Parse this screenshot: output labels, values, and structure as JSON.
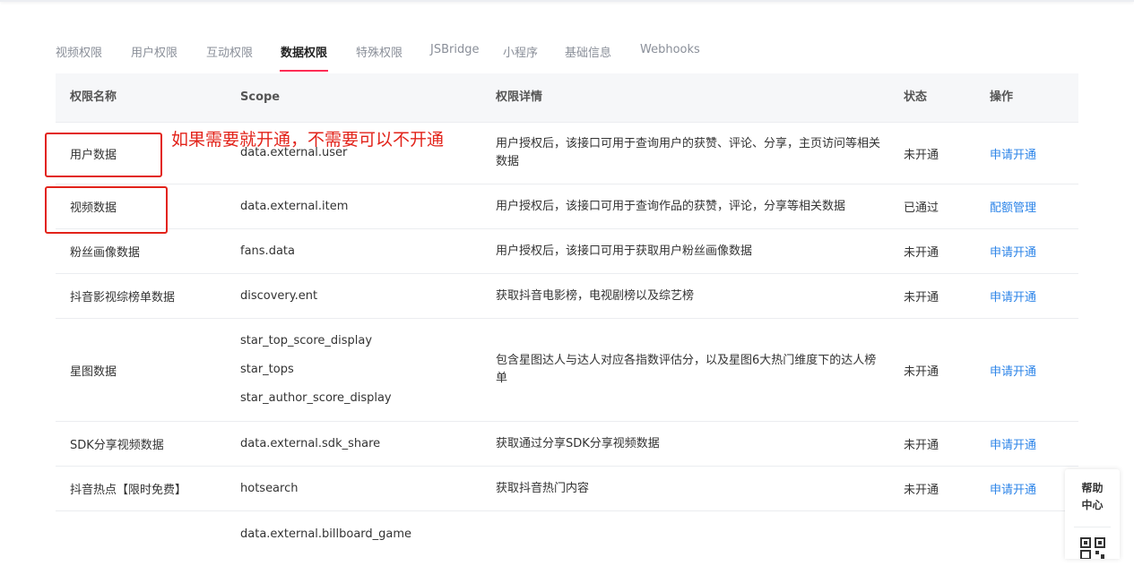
{
  "tabs": [
    {
      "label": "视频权限",
      "active": false
    },
    {
      "label": "用户权限",
      "active": false
    },
    {
      "label": "互动权限",
      "active": false
    },
    {
      "label": "数据权限",
      "active": true
    },
    {
      "label": "特殊权限",
      "active": false
    },
    {
      "label": "JSBridge",
      "active": false
    },
    {
      "label": "小程序",
      "active": false
    },
    {
      "label": "基础信息",
      "active": false
    },
    {
      "label": "Webhooks",
      "active": false
    }
  ],
  "accent_color": "#fe2c55",
  "link_color": "#2c84e8",
  "table": {
    "headers": {
      "name": "权限名称",
      "scope": "Scope",
      "detail": "权限详情",
      "status": "状态",
      "op": "操作"
    },
    "rows": [
      {
        "name": "用户数据",
        "scopes": [
          "data.external.user"
        ],
        "detail": "用户授权后，该接口可用于查询用户的获赞、评论、分享，主页访问等相关数据",
        "status": "未开通",
        "op": "申请开通"
      },
      {
        "name": "视频数据",
        "scopes": [
          "data.external.item"
        ],
        "detail": "用户授权后，该接口可用于查询作品的获赞，评论，分享等相关数据",
        "status": "已通过",
        "op": "配额管理"
      },
      {
        "name": "粉丝画像数据",
        "scopes": [
          "fans.data"
        ],
        "detail": "用户授权后，该接口可用于获取用户粉丝画像数据",
        "status": "未开通",
        "op": "申请开通"
      },
      {
        "name": "抖音影视综榜单数据",
        "scopes": [
          "discovery.ent"
        ],
        "detail": "获取抖音电影榜，电视剧榜以及综艺榜",
        "status": "未开通",
        "op": "申请开通"
      },
      {
        "name": "星图数据",
        "scopes": [
          "star_top_score_display",
          "star_tops",
          "star_author_score_display"
        ],
        "detail": "包含星图达人与达人对应各指数评估分，以及星图6大热门维度下的达人榜单",
        "status": "未开通",
        "op": "申请开通"
      },
      {
        "name": "SDK分享视频数据",
        "scopes": [
          "data.external.sdk_share"
        ],
        "detail": "获取通过分享SDK分享视频数据",
        "status": "未开通",
        "op": "申请开通"
      },
      {
        "name": "抖音热点【限时免费】",
        "scopes": [
          "hotsearch"
        ],
        "detail": "获取抖音热门内容",
        "status": "未开通",
        "op": "申请开通"
      },
      {
        "name": "",
        "scopes": [
          "data.external.billboard_game"
        ],
        "detail": "",
        "status": "",
        "op": ""
      }
    ]
  },
  "annotation": {
    "text": "如果需要就开通，不需要可以不开通",
    "color": "#e2231a"
  },
  "help_widget": {
    "label_line1": "帮助",
    "label_line2": "中心",
    "icon": "qr-code-icon"
  }
}
